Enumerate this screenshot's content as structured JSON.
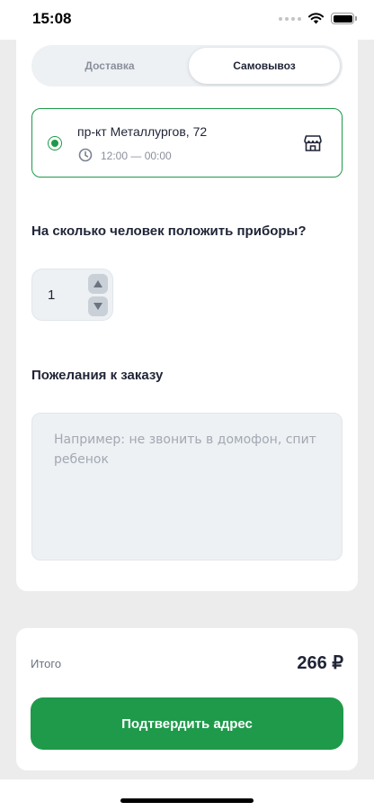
{
  "status_bar": {
    "time": "15:08"
  },
  "delivery_tabs": [
    {
      "label": "Доставка",
      "active": false
    },
    {
      "label": "Самовывоз",
      "active": true
    }
  ],
  "pickup_point": {
    "address": "пр-кт Металлургов, 72",
    "hours": "12:00 — 00:00",
    "selected": true,
    "icon": "store-icon"
  },
  "cutlery": {
    "title": "На сколько человек положить приборы?",
    "value": "1"
  },
  "wishes": {
    "title": "Пожелания к заказу",
    "placeholder": "Например: не звонить в домофон, спит ребенок",
    "value": ""
  },
  "summary": {
    "total_label": "Итого",
    "total_amount": "266 ₽"
  },
  "confirm_button": {
    "label": "Подтвердить адрес"
  },
  "colors": {
    "accent": "#1e9a4a",
    "field_background": "#edf1f4",
    "page_background": "#ececec"
  }
}
